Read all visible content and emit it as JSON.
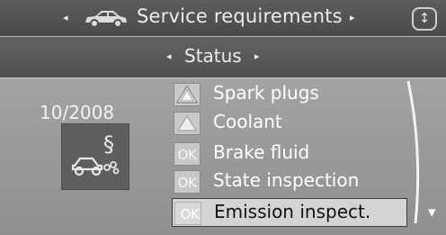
{
  "header": {
    "title": "Service requirements",
    "left_arrow": "◂",
    "right_arrow": "▸",
    "scroll_glyph": "↕",
    "car_icon": "car-icon"
  },
  "status_bar": {
    "label": "Status",
    "left_arrow": "◂",
    "right_arrow": "▸"
  },
  "due_date": "10/2008",
  "symbol_icon": "emission-inspection-icon",
  "items": [
    {
      "label": "Spark plugs",
      "status": "warning",
      "status_text": ""
    },
    {
      "label": "Coolant",
      "status": "warning",
      "status_text": ""
    },
    {
      "label": "Brake fluid",
      "status": "ok",
      "status_text": "OK"
    },
    {
      "label": "State inspection",
      "status": "ok",
      "status_text": "OK"
    },
    {
      "label": "Emission inspect.",
      "status": "ok",
      "status_text": "OK",
      "selected": true
    }
  ],
  "scroll_down_glyph": "▾",
  "colors": {
    "header_bg": "#4f4f4f",
    "body_bg": "#999999",
    "selected_bg": "#d4d4d4",
    "text": "#ffffff"
  }
}
